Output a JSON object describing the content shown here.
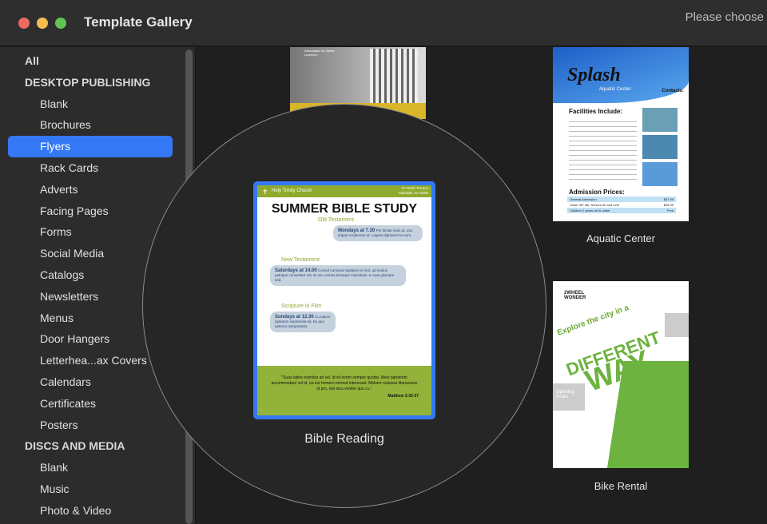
{
  "window": {
    "title": "Template Gallery",
    "right_text": "Please choose",
    "colors": {
      "close": "#ed6a5e",
      "minimize": "#f5bf4f",
      "zoom": "#61c554",
      "accent": "#3478f6"
    }
  },
  "sidebar": {
    "items": [
      {
        "label": "All",
        "type": "header"
      },
      {
        "label": "DESKTOP PUBLISHING",
        "type": "header"
      },
      {
        "label": "Blank"
      },
      {
        "label": "Brochures"
      },
      {
        "label": "Flyers",
        "selected": true
      },
      {
        "label": "Rack Cards"
      },
      {
        "label": "Adverts"
      },
      {
        "label": "Facing Pages"
      },
      {
        "label": "Forms"
      },
      {
        "label": "Social Media"
      },
      {
        "label": "Catalogs"
      },
      {
        "label": "Newsletters"
      },
      {
        "label": "Menus"
      },
      {
        "label": "Door Hangers"
      },
      {
        "label": "Letterhea...ax Covers"
      },
      {
        "label": "Calendars"
      },
      {
        "label": "Certificates"
      },
      {
        "label": "Posters"
      },
      {
        "label": "DISCS AND MEDIA",
        "type": "header"
      },
      {
        "label": "Blank"
      },
      {
        "label": "Music"
      },
      {
        "label": "Photo & Video"
      }
    ]
  },
  "templates": {
    "top_left": {
      "text": "Association for Better Learners"
    },
    "aquatic": {
      "label": "Aquatic Center",
      "brand": "Splash",
      "sub": "Aquatic Center",
      "contacts": "Contacts:",
      "facilities": "Facilities Include:",
      "admission": "Admission Prices:",
      "prices": [
        [
          "General Admission",
          "$37.99"
        ],
        [
          "Under 48\" tall, Seniors 60 and over",
          "$28.99"
        ],
        [
          "Children 2 years old & under",
          "Free"
        ]
      ]
    },
    "bible": {
      "label": "Bible Reading",
      "church": "Holy Trinity Church",
      "address": "67 North Terrace Adelaide, GA 6000",
      "title": "SUMMER BIBLE STUDY",
      "sections": [
        {
          "heading": "Old Testament",
          "time": "Mondays at 7.30",
          "text": "Per dictas inani at, usu eripuit scriptorem ut. Legere dignissim te eum."
        },
        {
          "heading": "New Testament",
          "time": "Saturdays at 14.00",
          "text": "Consul nominavi luptatum ei mol, ad mutius patrique consetetur est. Ei nec omnes lectoque molestiais, in suas gloriatur sed."
        },
        {
          "heading": "Scripture in Film",
          "time": "Sundays at 12.30",
          "text": "Cu natum luptatum expetenda sit. Eu quo aeterno interpretaris."
        }
      ],
      "quote": "\"Suas latine evertitur ad vel, id sit lorem semper quodsi. Meis partiendo accommodare vel id, ea ius homero eirmod interesset. Meliore noluisse liberavisse id pro, nisi eius veniter quo cu.\"",
      "citation": "Matthew 3:35-37"
    },
    "bike": {
      "label": "Bike Rental",
      "brand": "2WHEEL WONDER",
      "headline": "Explore the city in a",
      "big1": "DIFFERENT",
      "big2": "WAY",
      "hours": "Opening hours"
    }
  }
}
